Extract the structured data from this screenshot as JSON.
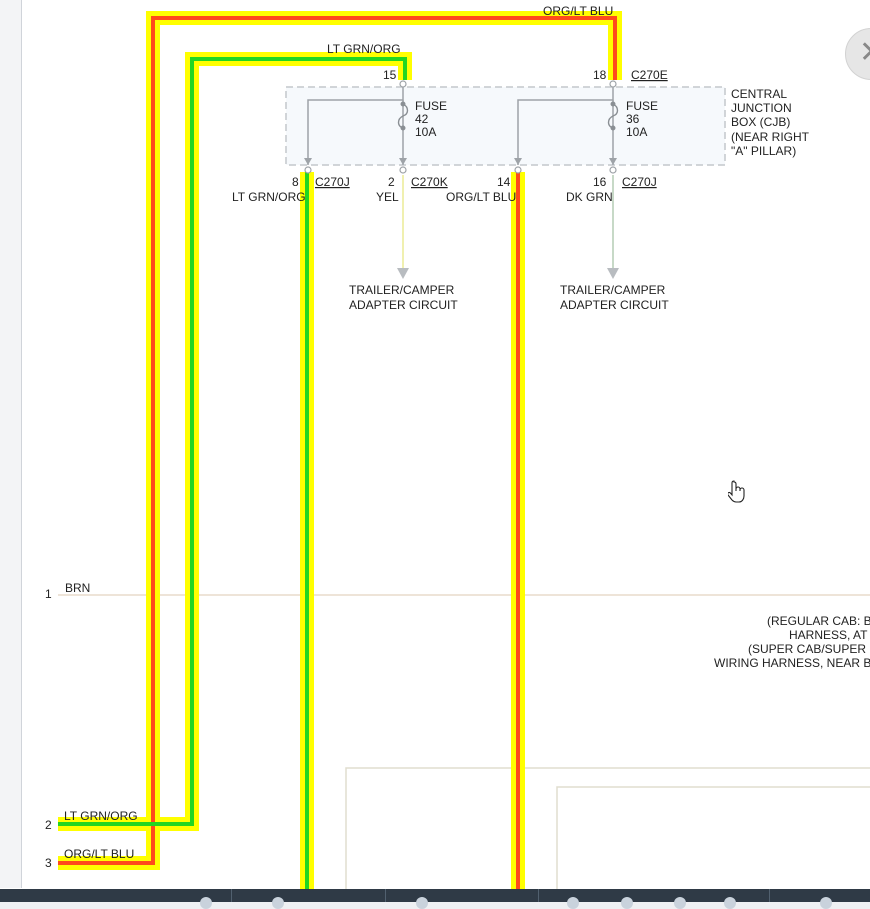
{
  "wire_top_orglt_blu": "ORG/LT BLU",
  "wire_top_ltgrn_org": "LT GRN/ORG",
  "cjb": {
    "pin_in_left": "15",
    "pin_in_right": "18",
    "connector_in_right": "C270E",
    "fuse_left": {
      "word": "FUSE",
      "number": "42",
      "rating": "10A"
    },
    "fuse_right": {
      "word": "FUSE",
      "number": "36",
      "rating": "10A"
    },
    "label_lines": [
      "CENTRAL",
      "JUNCTION",
      "BOX (CJB)",
      "(NEAR RIGHT",
      "\"A\" PILLAR)"
    ]
  },
  "outputs": [
    {
      "pin": "8",
      "connector": "C270J",
      "wire": "LT GRN/ORG"
    },
    {
      "pin": "2",
      "connector": "C270K",
      "wire": "YEL"
    },
    {
      "pin": "14",
      "connector": "",
      "wire": "ORG/LT BLU"
    },
    {
      "pin": "16",
      "connector": "C270J",
      "wire": "DK GRN"
    }
  ],
  "trailer_left": [
    "TRAILER/CAMPER",
    "ADAPTER CIRCUIT"
  ],
  "trailer_right": [
    "TRAILER/CAMPER",
    "ADAPTER CIRCUIT"
  ],
  "left_pins": [
    {
      "num": "1",
      "wire": "BRN"
    },
    {
      "num": "2",
      "wire": "LT GRN/ORG"
    },
    {
      "num": "3",
      "wire": "ORG/LT BLU"
    }
  ],
  "note_lines": [
    "(REGULAR CAB: BO",
    "HARNESS, AT I",
    "(SUPER CAB/SUPER C",
    "WIRING HARNESS, NEAR BR"
  ],
  "colors": {
    "highlight": "#ffff00",
    "org": "#ff4a1c",
    "lt_grn": "#22d622",
    "yel_wire": "#f0f0b0",
    "dk_grn_wire": "#c7d9c7",
    "brn_wire": "#e8dccb",
    "cjb_border": "#c3c7cc",
    "cjb_fill": "#f6f9fc"
  },
  "close_icon": "x-icon",
  "cursor_icon": "hand-pointer-icon"
}
